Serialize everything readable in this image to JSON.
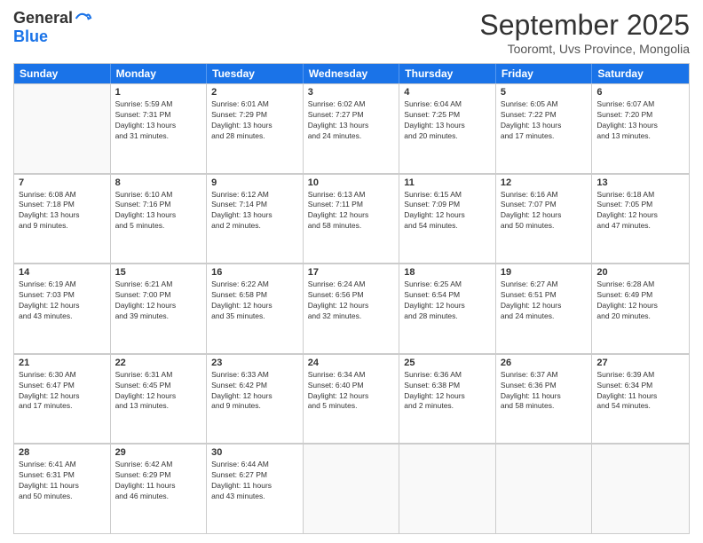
{
  "header": {
    "logo_general": "General",
    "logo_blue": "Blue",
    "month": "September 2025",
    "location": "Tooromt, Uvs Province, Mongolia"
  },
  "days_of_week": [
    "Sunday",
    "Monday",
    "Tuesday",
    "Wednesday",
    "Thursday",
    "Friday",
    "Saturday"
  ],
  "weeks": [
    [
      {
        "day": "",
        "info": ""
      },
      {
        "day": "1",
        "info": "Sunrise: 5:59 AM\nSunset: 7:31 PM\nDaylight: 13 hours\nand 31 minutes."
      },
      {
        "day": "2",
        "info": "Sunrise: 6:01 AM\nSunset: 7:29 PM\nDaylight: 13 hours\nand 28 minutes."
      },
      {
        "day": "3",
        "info": "Sunrise: 6:02 AM\nSunset: 7:27 PM\nDaylight: 13 hours\nand 24 minutes."
      },
      {
        "day": "4",
        "info": "Sunrise: 6:04 AM\nSunset: 7:25 PM\nDaylight: 13 hours\nand 20 minutes."
      },
      {
        "day": "5",
        "info": "Sunrise: 6:05 AM\nSunset: 7:22 PM\nDaylight: 13 hours\nand 17 minutes."
      },
      {
        "day": "6",
        "info": "Sunrise: 6:07 AM\nSunset: 7:20 PM\nDaylight: 13 hours\nand 13 minutes."
      }
    ],
    [
      {
        "day": "7",
        "info": "Sunrise: 6:08 AM\nSunset: 7:18 PM\nDaylight: 13 hours\nand 9 minutes."
      },
      {
        "day": "8",
        "info": "Sunrise: 6:10 AM\nSunset: 7:16 PM\nDaylight: 13 hours\nand 5 minutes."
      },
      {
        "day": "9",
        "info": "Sunrise: 6:12 AM\nSunset: 7:14 PM\nDaylight: 13 hours\nand 2 minutes."
      },
      {
        "day": "10",
        "info": "Sunrise: 6:13 AM\nSunset: 7:11 PM\nDaylight: 12 hours\nand 58 minutes."
      },
      {
        "day": "11",
        "info": "Sunrise: 6:15 AM\nSunset: 7:09 PM\nDaylight: 12 hours\nand 54 minutes."
      },
      {
        "day": "12",
        "info": "Sunrise: 6:16 AM\nSunset: 7:07 PM\nDaylight: 12 hours\nand 50 minutes."
      },
      {
        "day": "13",
        "info": "Sunrise: 6:18 AM\nSunset: 7:05 PM\nDaylight: 12 hours\nand 47 minutes."
      }
    ],
    [
      {
        "day": "14",
        "info": "Sunrise: 6:19 AM\nSunset: 7:03 PM\nDaylight: 12 hours\nand 43 minutes."
      },
      {
        "day": "15",
        "info": "Sunrise: 6:21 AM\nSunset: 7:00 PM\nDaylight: 12 hours\nand 39 minutes."
      },
      {
        "day": "16",
        "info": "Sunrise: 6:22 AM\nSunset: 6:58 PM\nDaylight: 12 hours\nand 35 minutes."
      },
      {
        "day": "17",
        "info": "Sunrise: 6:24 AM\nSunset: 6:56 PM\nDaylight: 12 hours\nand 32 minutes."
      },
      {
        "day": "18",
        "info": "Sunrise: 6:25 AM\nSunset: 6:54 PM\nDaylight: 12 hours\nand 28 minutes."
      },
      {
        "day": "19",
        "info": "Sunrise: 6:27 AM\nSunset: 6:51 PM\nDaylight: 12 hours\nand 24 minutes."
      },
      {
        "day": "20",
        "info": "Sunrise: 6:28 AM\nSunset: 6:49 PM\nDaylight: 12 hours\nand 20 minutes."
      }
    ],
    [
      {
        "day": "21",
        "info": "Sunrise: 6:30 AM\nSunset: 6:47 PM\nDaylight: 12 hours\nand 17 minutes."
      },
      {
        "day": "22",
        "info": "Sunrise: 6:31 AM\nSunset: 6:45 PM\nDaylight: 12 hours\nand 13 minutes."
      },
      {
        "day": "23",
        "info": "Sunrise: 6:33 AM\nSunset: 6:42 PM\nDaylight: 12 hours\nand 9 minutes."
      },
      {
        "day": "24",
        "info": "Sunrise: 6:34 AM\nSunset: 6:40 PM\nDaylight: 12 hours\nand 5 minutes."
      },
      {
        "day": "25",
        "info": "Sunrise: 6:36 AM\nSunset: 6:38 PM\nDaylight: 12 hours\nand 2 minutes."
      },
      {
        "day": "26",
        "info": "Sunrise: 6:37 AM\nSunset: 6:36 PM\nDaylight: 11 hours\nand 58 minutes."
      },
      {
        "day": "27",
        "info": "Sunrise: 6:39 AM\nSunset: 6:34 PM\nDaylight: 11 hours\nand 54 minutes."
      }
    ],
    [
      {
        "day": "28",
        "info": "Sunrise: 6:41 AM\nSunset: 6:31 PM\nDaylight: 11 hours\nand 50 minutes."
      },
      {
        "day": "29",
        "info": "Sunrise: 6:42 AM\nSunset: 6:29 PM\nDaylight: 11 hours\nand 46 minutes."
      },
      {
        "day": "30",
        "info": "Sunrise: 6:44 AM\nSunset: 6:27 PM\nDaylight: 11 hours\nand 43 minutes."
      },
      {
        "day": "",
        "info": ""
      },
      {
        "day": "",
        "info": ""
      },
      {
        "day": "",
        "info": ""
      },
      {
        "day": "",
        "info": ""
      }
    ]
  ]
}
